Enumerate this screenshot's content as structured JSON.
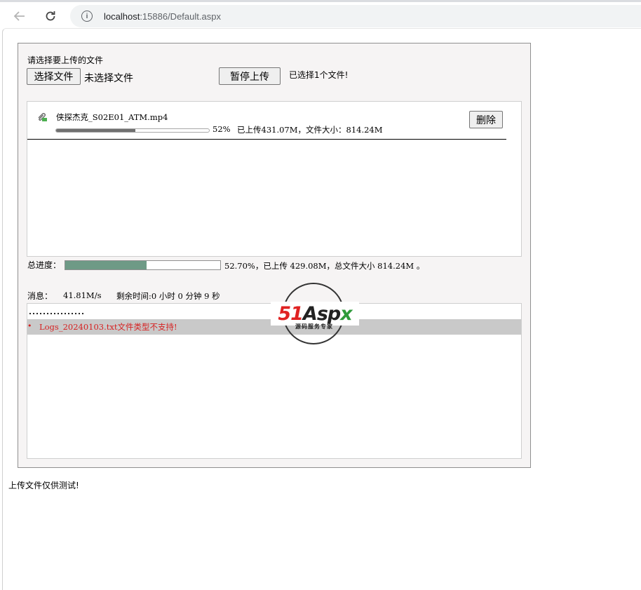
{
  "browser": {
    "url_host": "localhost",
    "url_rest": ":15886/Default.aspx"
  },
  "upload": {
    "prompt": "请选择要上传的文件",
    "choose_button": "选择文件",
    "no_file_text": "未选择文件",
    "pause_button": "暂停上传",
    "selected_text": "已选择1个文件!"
  },
  "file_item": {
    "name": "侠探杰克_S02E01_ATM.mp4",
    "progress_fraction": 0.52,
    "percent_text": "52%",
    "detail": "已上传431.07M，文件大小：814.24M",
    "delete_button": "删除"
  },
  "total": {
    "label": "总进度：",
    "progress_fraction": 0.527,
    "text": "52.70%，已上传 429.08M，总文件大小 814.24M 。"
  },
  "message": {
    "label": "消息：",
    "speed": "41.81M/s",
    "remaining": "剩余时间:0 小时 0 分钟 9 秒",
    "dots": "................",
    "error": "Logs_20240103.txt文件类型不支持!"
  },
  "watermark": {
    "brand_51": "51",
    "brand_a": "Asp",
    "brand_x": "x",
    "subtitle": "源码服务专家"
  },
  "footer": {
    "note": "上传文件仅供测试!"
  },
  "colors": {
    "panel_bg": "#f6f4f4",
    "total_fill": "#6e9a86",
    "error_text": "#d62020",
    "error_row_bg": "#c9c9c9"
  }
}
